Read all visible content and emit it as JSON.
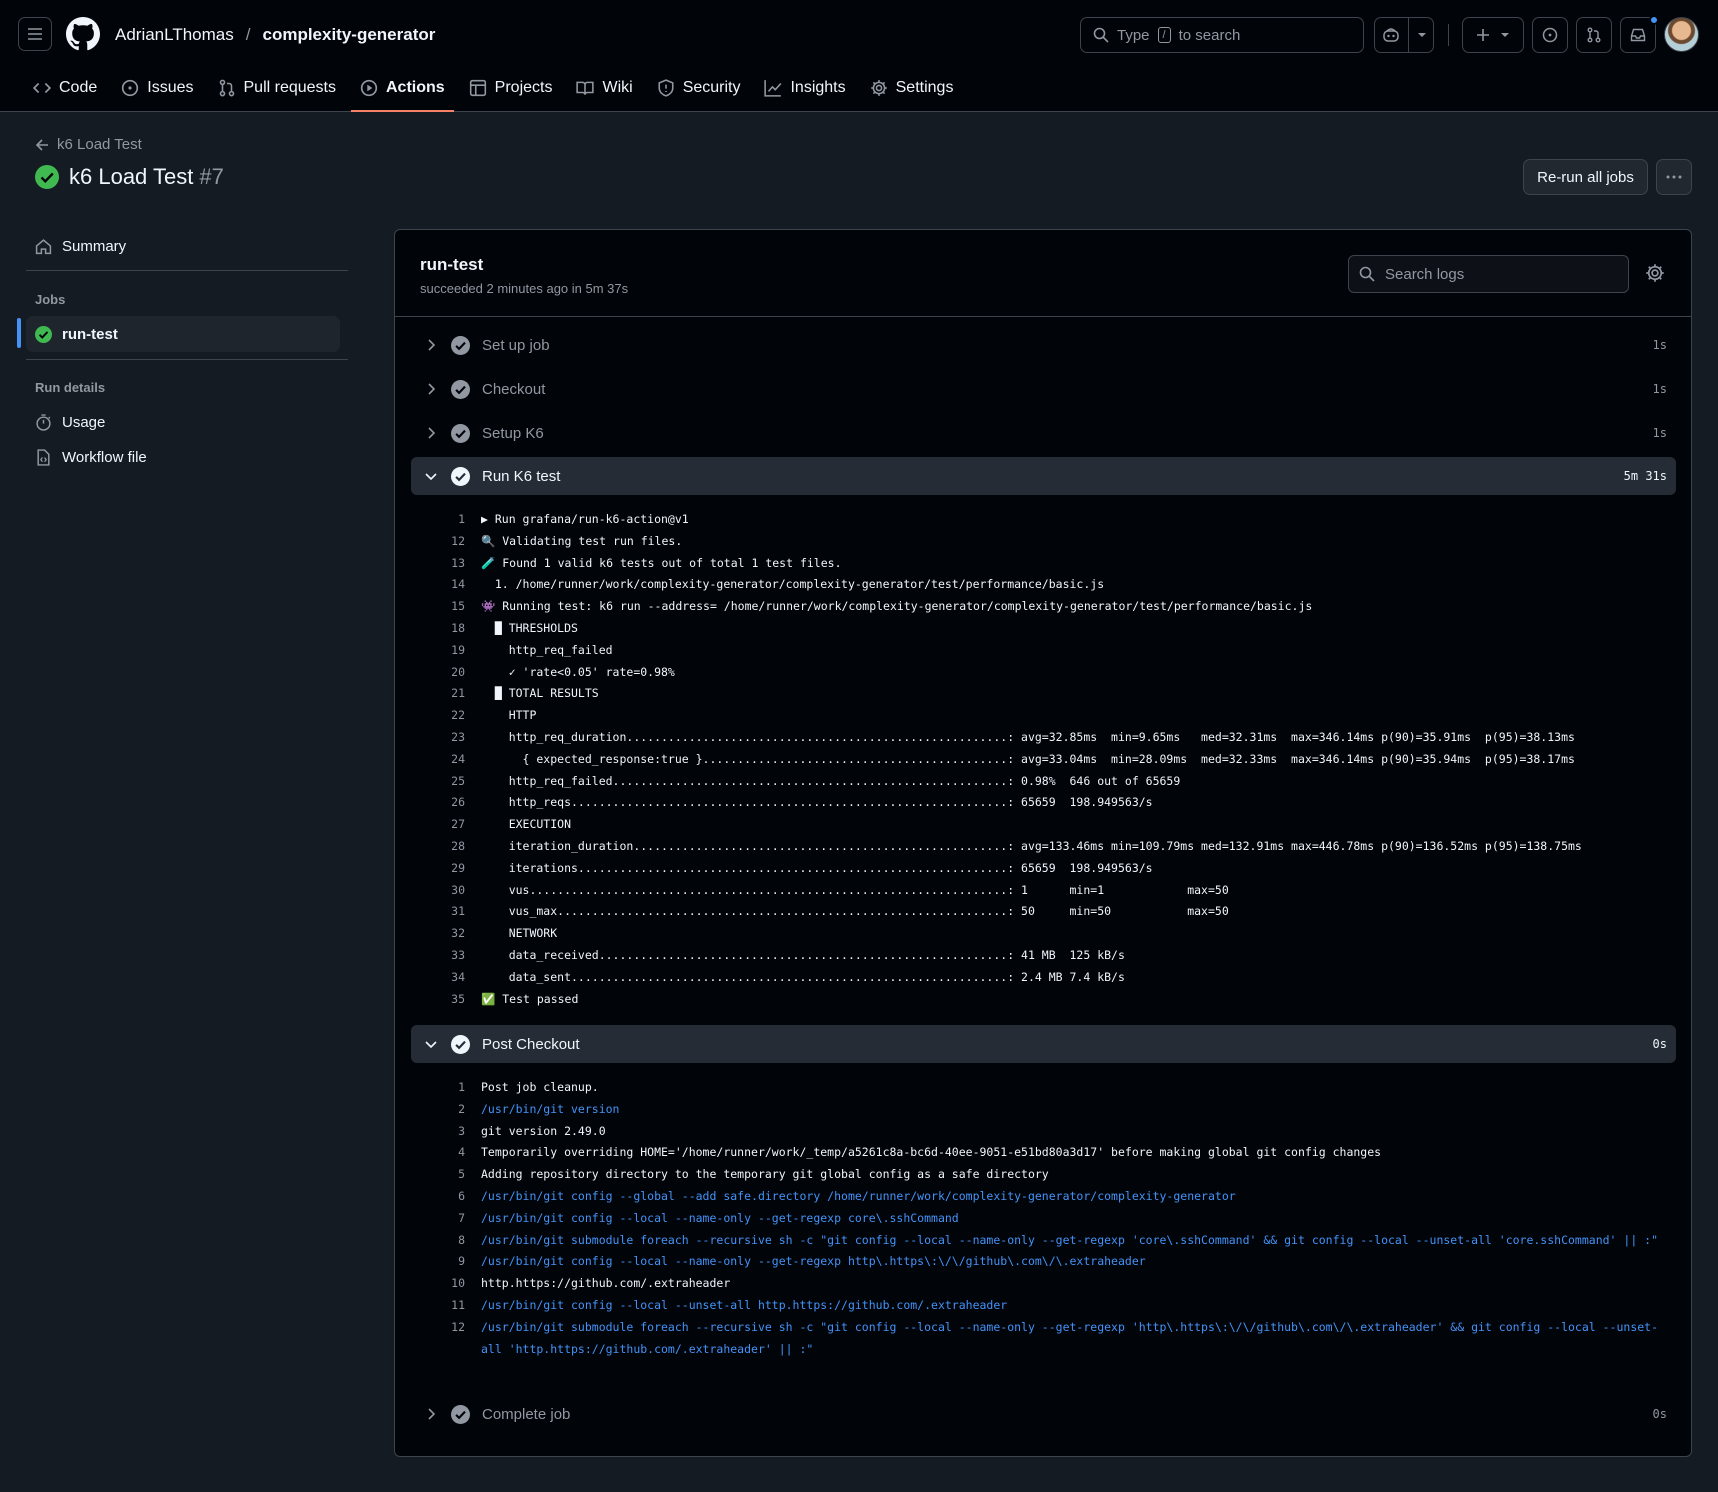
{
  "header": {
    "owner": "AdrianLThomas",
    "separator": "/",
    "repo": "complexity-generator",
    "search_prefix": "Type",
    "search_key": "/",
    "search_suffix": "to search"
  },
  "repo_nav": {
    "tabs": [
      {
        "label": "Code",
        "icon": "code-icon"
      },
      {
        "label": "Issues",
        "icon": "issue-icon"
      },
      {
        "label": "Pull requests",
        "icon": "pull-request-icon"
      },
      {
        "label": "Actions",
        "icon": "play-icon",
        "active": true
      },
      {
        "label": "Projects",
        "icon": "table-icon"
      },
      {
        "label": "Wiki",
        "icon": "book-icon"
      },
      {
        "label": "Security",
        "icon": "shield-icon"
      },
      {
        "label": "Insights",
        "icon": "graph-icon"
      },
      {
        "label": "Settings",
        "icon": "gear-icon"
      }
    ]
  },
  "page": {
    "back_label": "k6 Load Test",
    "title": "k6 Load Test",
    "run_number": "#7",
    "rerun_label": "Re-run all jobs"
  },
  "sidebar": {
    "summary": "Summary",
    "jobs_heading": "Jobs",
    "job": "run-test",
    "run_details_heading": "Run details",
    "usage": "Usage",
    "workflow_file": "Workflow file"
  },
  "job": {
    "name": "run-test",
    "status": "succeeded 2 minutes ago in 5m 37s",
    "search_placeholder": "Search logs",
    "steps": [
      {
        "label": "Set up job",
        "duration": "1s"
      },
      {
        "label": "Checkout",
        "duration": "1s"
      },
      {
        "label": "Setup K6",
        "duration": "1s"
      },
      {
        "label": "Run K6 test",
        "duration": "5m 31s"
      },
      {
        "label": "Post Checkout",
        "duration": "0s"
      },
      {
        "label": "Complete job",
        "duration": "0s"
      }
    ]
  },
  "k6_log": [
    {
      "n": "1",
      "t": "▶ Run grafana/run-k6-action@v1"
    },
    {
      "n": "12",
      "t": "🔍 Validating test run files."
    },
    {
      "n": "13",
      "t": "🧪 Found 1 valid k6 tests out of total 1 test files."
    },
    {
      "n": "14",
      "t": "  1. /home/runner/work/complexity-generator/complexity-generator/test/performance/basic.js"
    },
    {
      "n": "15",
      "t": "👾 Running test: k6 run --address= /home/runner/work/complexity-generator/complexity-generator/test/performance/basic.js"
    },
    {
      "n": "18",
      "t": "  █ THRESHOLDS"
    },
    {
      "n": "19",
      "t": "    http_req_failed"
    },
    {
      "n": "20",
      "t": "    ✓ 'rate<0.05' rate=0.98%"
    },
    {
      "n": "21",
      "t": "  █ TOTAL RESULTS"
    },
    {
      "n": "22",
      "t": "    HTTP"
    },
    {
      "n": "23",
      "t": "    http_req_duration.......................................................: avg=32.85ms  min=9.65ms   med=32.31ms  max=346.14ms p(90)=35.91ms  p(95)=38.13ms"
    },
    {
      "n": "24",
      "t": "      { expected_response:true }............................................: avg=33.04ms  min=28.09ms  med=32.33ms  max=346.14ms p(90)=35.94ms  p(95)=38.17ms"
    },
    {
      "n": "25",
      "t": "    http_req_failed.........................................................: 0.98%  646 out of 65659"
    },
    {
      "n": "26",
      "t": "    http_reqs...............................................................: 65659  198.949563/s"
    },
    {
      "n": "27",
      "t": "    EXECUTION"
    },
    {
      "n": "28",
      "t": "    iteration_duration......................................................: avg=133.46ms min=109.79ms med=132.91ms max=446.78ms p(90)=136.52ms p(95)=138.75ms"
    },
    {
      "n": "29",
      "t": "    iterations..............................................................: 65659  198.949563/s"
    },
    {
      "n": "30",
      "t": "    vus.....................................................................: 1      min=1            max=50"
    },
    {
      "n": "31",
      "t": "    vus_max.................................................................: 50     min=50           max=50"
    },
    {
      "n": "32",
      "t": "    NETWORK"
    },
    {
      "n": "33",
      "t": "    data_received...........................................................: 41 MB  125 kB/s"
    },
    {
      "n": "34",
      "t": "    data_sent...............................................................: 2.4 MB 7.4 kB/s"
    },
    {
      "n": "35",
      "t": "✅ Test passed"
    }
  ],
  "post_log": [
    {
      "n": "1",
      "t": "Post job cleanup.",
      "blue": false
    },
    {
      "n": "2",
      "t": "/usr/bin/git version",
      "blue": true
    },
    {
      "n": "3",
      "t": "git version 2.49.0",
      "blue": false
    },
    {
      "n": "4",
      "t": "Temporarily overriding HOME='/home/runner/work/_temp/a5261c8a-bc6d-40ee-9051-e51bd80a3d17' before making global git config changes",
      "blue": false
    },
    {
      "n": "5",
      "t": "Adding repository directory to the temporary git global config as a safe directory",
      "blue": false
    },
    {
      "n": "6",
      "t": "/usr/bin/git config --global --add safe.directory /home/runner/work/complexity-generator/complexity-generator",
      "blue": true
    },
    {
      "n": "7",
      "t": "/usr/bin/git config --local --name-only --get-regexp core\\.sshCommand",
      "blue": true
    },
    {
      "n": "8",
      "t": "/usr/bin/git submodule foreach --recursive sh -c \"git config --local --name-only --get-regexp 'core\\.sshCommand' && git config --local --unset-all 'core.sshCommand' || :\"",
      "blue": true,
      "wrap": true
    },
    {
      "n": "9",
      "t": "/usr/bin/git config --local --name-only --get-regexp http\\.https\\:\\/\\/github\\.com\\/\\.extraheader",
      "blue": true
    },
    {
      "n": "10",
      "t": "http.https://github.com/.extraheader",
      "blue": false
    },
    {
      "n": "11",
      "t": "/usr/bin/git config --local --unset-all http.https://github.com/.extraheader",
      "blue": true
    },
    {
      "n": "12",
      "t": "/usr/bin/git submodule foreach --recursive sh -c \"git config --local --name-only --get-regexp 'http\\.https\\:\\/\\/github\\.com\\/\\.extraheader' && git config --local --unset-all 'http.https://github.com/.extraheader' || :\"",
      "blue": true,
      "wrap": true
    }
  ],
  "colors": {
    "success": "#3fb950",
    "accent": "#4493f8",
    "tab_underline": "#f78166"
  }
}
